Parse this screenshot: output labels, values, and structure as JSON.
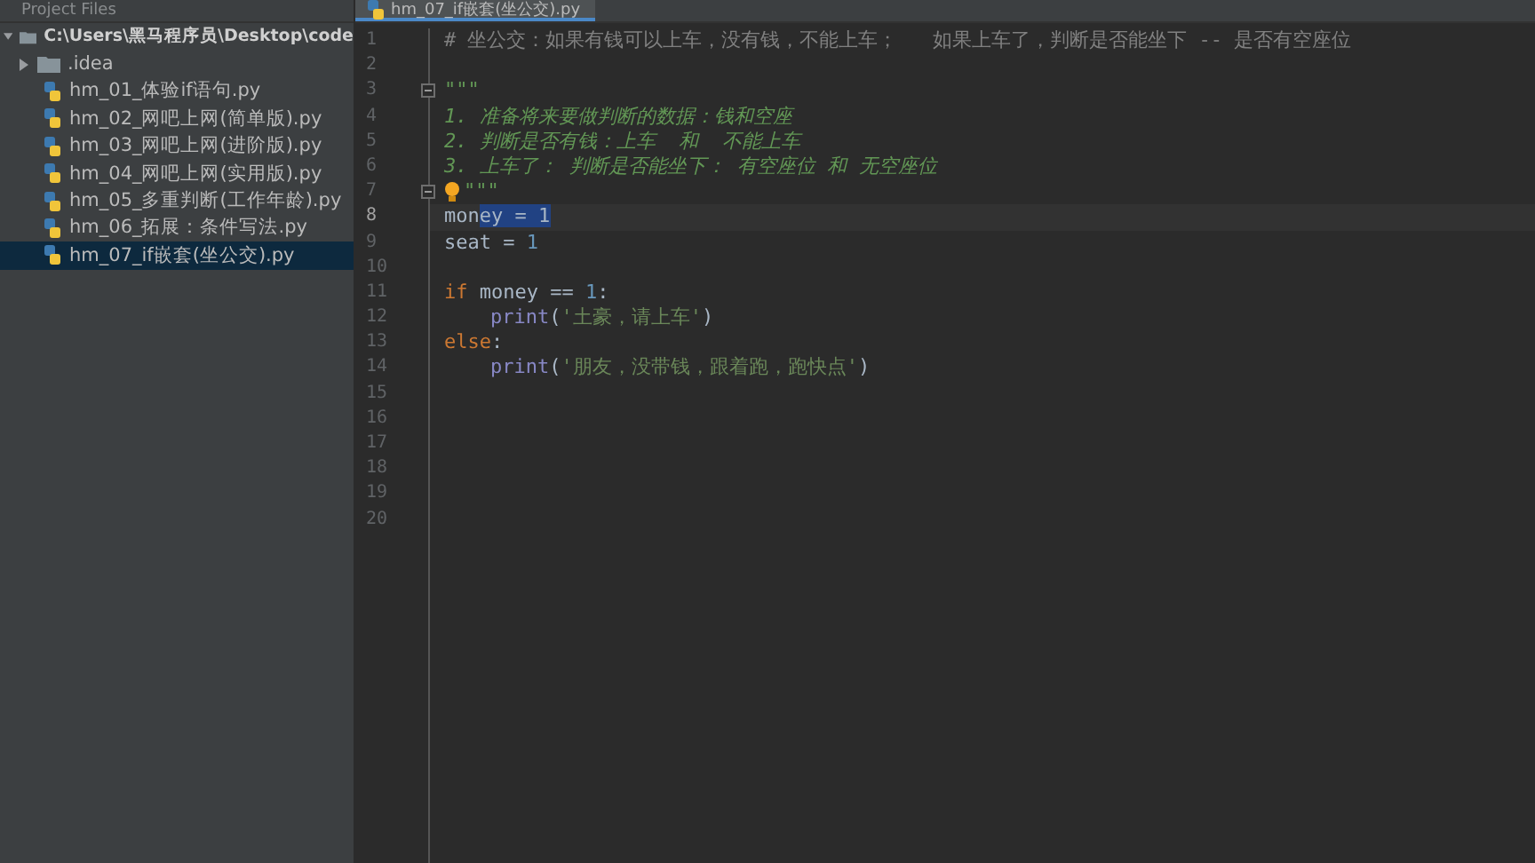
{
  "sidebar": {
    "title": "Project Files",
    "root": {
      "label": "C:\\Users\\黑马程序员\\Desktop\\code",
      "expanded": true,
      "children": [
        {
          "kind": "folder",
          "label": ".idea",
          "expanded": false,
          "selected": false
        },
        {
          "kind": "file",
          "label": "hm_01_体验if语句.py",
          "selected": false
        },
        {
          "kind": "file",
          "label": "hm_02_网吧上网(简单版).py",
          "selected": false
        },
        {
          "kind": "file",
          "label": "hm_03_网吧上网(进阶版).py",
          "selected": false
        },
        {
          "kind": "file",
          "label": "hm_04_网吧上网(实用版).py",
          "selected": false
        },
        {
          "kind": "file",
          "label": "hm_05_多重判断(工作年龄).py",
          "selected": false
        },
        {
          "kind": "file",
          "label": "hm_06_拓展：条件写法.py",
          "selected": false
        },
        {
          "kind": "file",
          "label": "hm_07_if嵌套(坐公交).py",
          "selected": true
        }
      ]
    }
  },
  "editor": {
    "tab": {
      "label": "hm_07_if嵌套(坐公交).py",
      "selected": true
    },
    "lines": [
      {
        "number": "1",
        "current": false,
        "fold": false,
        "bulb": false,
        "indented": false,
        "tokens": [
          {
            "kind": "comment",
            "text": "# 坐公交：如果有钱可以上车，没有钱，不能上车；   如果上车了，判断是否能坐下 -- 是否有空座位"
          }
        ]
      },
      {
        "number": "2",
        "current": false,
        "fold": false,
        "bulb": false
      },
      {
        "number": "3",
        "current": false,
        "fold": true,
        "bulb": false,
        "indented": false,
        "tokens": [
          {
            "kind": "docstring",
            "text": "\"\"\""
          }
        ]
      },
      {
        "number": "4",
        "current": false,
        "fold": false,
        "bulb": false,
        "indented": false,
        "tokens": [
          {
            "kind": "docstring",
            "text": "1. 准备将来要做判断的数据：钱和空座"
          }
        ]
      },
      {
        "number": "5",
        "current": false,
        "fold": false,
        "bulb": false,
        "indented": false,
        "tokens": [
          {
            "kind": "docstring",
            "text": "2. 判断是否有钱：上车  和  不能上车"
          }
        ]
      },
      {
        "number": "6",
        "current": false,
        "fold": false,
        "bulb": false,
        "indented": false,
        "tokens": [
          {
            "kind": "docstring",
            "text": "3. 上车了： 判断是否能坐下： 有空座位 和 无空座位"
          }
        ]
      },
      {
        "number": "7",
        "current": false,
        "fold": true,
        "bulb": true,
        "indented": false,
        "tokens": [
          {
            "kind": "docstring",
            "text": "\"\"\""
          }
        ]
      },
      {
        "number": "8",
        "current": true,
        "fold": false,
        "bulb": false,
        "indented": false,
        "tokens": [
          {
            "kind": "plain",
            "text": "mon"
          },
          {
            "kind": "selection",
            "text": "ey = 1"
          }
        ]
      },
      {
        "number": "9",
        "current": false,
        "fold": false,
        "bulb": false,
        "indented": false,
        "tokens": [
          {
            "kind": "plain",
            "text": "seat = "
          },
          {
            "kind": "number",
            "text": "1"
          }
        ]
      },
      {
        "number": "10",
        "current": false,
        "fold": false,
        "bulb": false
      },
      {
        "number": "11",
        "current": false,
        "fold": false,
        "bulb": false,
        "indented": false,
        "tokens": [
          {
            "kind": "keyword",
            "text": "if"
          },
          {
            "kind": "plain",
            "text": " money == "
          },
          {
            "kind": "number",
            "text": "1"
          },
          {
            "kind": "plain",
            "text": ":"
          }
        ]
      },
      {
        "number": "12",
        "current": false,
        "fold": false,
        "bulb": false,
        "indented": true,
        "tokens": [
          {
            "kind": "builtin",
            "text": "print"
          },
          {
            "kind": "plain",
            "text": "("
          },
          {
            "kind": "string",
            "text": "'土豪，请上车'"
          },
          {
            "kind": "plain",
            "text": ")"
          }
        ]
      },
      {
        "number": "13",
        "current": false,
        "fold": false,
        "bulb": false,
        "indented": false,
        "tokens": [
          {
            "kind": "keyword",
            "text": "else"
          },
          {
            "kind": "plain",
            "text": ":"
          }
        ]
      },
      {
        "number": "14",
        "current": false,
        "fold": false,
        "bulb": false,
        "indented": true,
        "tokens": [
          {
            "kind": "builtin",
            "text": "print"
          },
          {
            "kind": "plain",
            "text": "("
          },
          {
            "kind": "string",
            "text": "'朋友，没带钱，跟着跑，跑快点'"
          },
          {
            "kind": "plain",
            "text": ")"
          }
        ]
      },
      {
        "number": "15",
        "current": false,
        "fold": false,
        "bulb": false
      },
      {
        "number": "16",
        "current": false,
        "fold": false,
        "bulb": false
      },
      {
        "number": "17",
        "current": false,
        "fold": false,
        "bulb": false
      },
      {
        "number": "18",
        "current": false,
        "fold": false,
        "bulb": false
      },
      {
        "number": "19",
        "current": false,
        "fold": false,
        "bulb": false
      },
      {
        "number": "20",
        "current": false,
        "fold": false,
        "bulb": false
      }
    ]
  }
}
